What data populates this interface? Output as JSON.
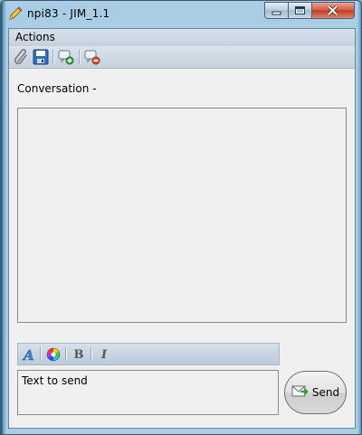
{
  "window": {
    "title": "npi83 - JIM_1.1",
    "icon": "pencil-icon",
    "controls": [
      "minimize",
      "maximize",
      "close"
    ]
  },
  "menubar": {
    "items": [
      {
        "label": "Actions"
      }
    ]
  },
  "toolbar": {
    "buttons": [
      {
        "name": "attach",
        "icon": "paperclip-icon"
      },
      {
        "name": "save",
        "icon": "floppy-disk-icon"
      },
      {
        "name": "add-contact",
        "icon": "chat-add-icon"
      },
      {
        "name": "remove-contact",
        "icon": "chat-remove-icon"
      }
    ]
  },
  "conversation": {
    "label": "Conversation -"
  },
  "formatting": {
    "buttons": [
      {
        "name": "font",
        "icon": "font-icon"
      },
      {
        "name": "color",
        "icon": "color-wheel-icon"
      },
      {
        "name": "bold",
        "label": "B"
      },
      {
        "name": "italic",
        "label": "I"
      }
    ]
  },
  "composer": {
    "value": "Text to send",
    "send_label": "Send",
    "send_icon": "envelope-send-icon"
  }
}
